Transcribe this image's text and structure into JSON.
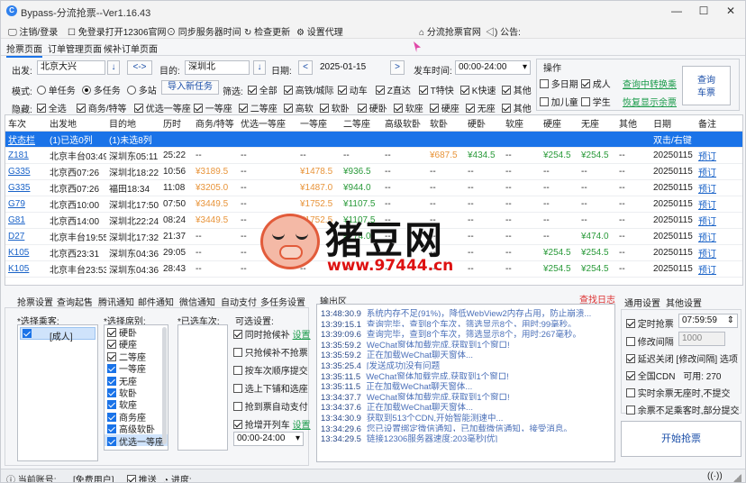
{
  "window": {
    "title": "Bypass-分流抢票--Ver1.16.43",
    "min": "—",
    "max": "☐",
    "close": "✕"
  },
  "menu": {
    "login": "注销/登录",
    "open12306": "免登录打开12306官网",
    "sync_time": "同步服务器时间",
    "check_update": "检查更新",
    "proxy": "设置代理",
    "website": "分流抢票官网",
    "announce": "公告:"
  },
  "tabs": [
    "抢票页面",
    "订单管理页面",
    "候补订单页面"
  ],
  "query": {
    "from_label": "出发:",
    "from": "北京大兴",
    "swap": "<->",
    "to_label": "目的:",
    "to": "深圳北",
    "date_label": "日期:",
    "date": "2025-01-15",
    "prev": "<",
    "next": ">",
    "time_label": "发车时间:",
    "time": "00:00-24:00",
    "arrow": "↓"
  },
  "mode": {
    "label": "模式:",
    "single": "单任务",
    "multi": "多任务",
    "station": "多站",
    "import": "导入新任务",
    "filter_label": "筛选:",
    "filters": [
      "全部",
      "高铁/城际",
      "动车",
      "Z直达",
      "T特快",
      "K快速",
      "其他"
    ]
  },
  "hide": {
    "label": "隐藏:",
    "items": [
      "全选",
      "商务/特等",
      "优选一等座",
      "一等座",
      "二等座",
      "高软",
      "软卧",
      "硬卧",
      "软座",
      "硬座",
      "无座",
      "其他"
    ]
  },
  "ops": {
    "title": "操作",
    "multi_date": "多日期",
    "adult": "成人",
    "transfer": "查询中转换乘",
    "child": "加儿童",
    "student": "学生",
    "restore": "恢复显示余票",
    "query": "查询\n车票"
  },
  "table": {
    "headers": [
      "车次",
      "出发地",
      "目的地",
      "历时",
      "商务/特等",
      "优选一等座",
      "一等座",
      "二等座",
      "高级软卧",
      "软卧",
      "硬卧",
      "软座",
      "硬座",
      "无座",
      "其他",
      "日期",
      "备注"
    ],
    "status_row": [
      "状态栏",
      "(1)已选0列",
      "(1)未选8列",
      "",
      "",
      "",
      "",
      "",
      "",
      "",
      "",
      "",
      "",
      "",
      "",
      "双击/右键",
      ""
    ],
    "rows": [
      [
        "Z181",
        "北京丰台03:49",
        "深圳东05:11",
        "25:22",
        "--",
        "--",
        "--",
        "--",
        "--",
        "¥687.5",
        "¥434.5",
        "--",
        "¥254.5",
        "¥254.5",
        "--",
        "20250115",
        "预订"
      ],
      [
        "G335",
        "北京西07:26",
        "深圳北18:22",
        "10:56",
        "¥3189.5",
        "--",
        "¥1478.5",
        "¥936.5",
        "--",
        "--",
        "--",
        "--",
        "--",
        "--",
        "--",
        "20250115",
        "预订"
      ],
      [
        "G335",
        "北京西07:26",
        "福田18:34",
        "11:08",
        "¥3205.0",
        "--",
        "¥1487.0",
        "¥944.0",
        "--",
        "--",
        "--",
        "--",
        "--",
        "--",
        "--",
        "20250115",
        "预订"
      ],
      [
        "G79",
        "北京西10:00",
        "深圳北17:50",
        "07:50",
        "¥3449.5",
        "--",
        "¥1752.5",
        "¥1107.5",
        "--",
        "--",
        "--",
        "--",
        "--",
        "--",
        "--",
        "20250115",
        "预订"
      ],
      [
        "G81",
        "北京西14:00",
        "深圳北22:24",
        "08:24",
        "¥3449.5",
        "--",
        "¥1752.5",
        "¥1107.5",
        "--",
        "--",
        "--",
        "--",
        "--",
        "--",
        "--",
        "20250115",
        "预订"
      ],
      [
        "D27",
        "北京丰台19:55",
        "深圳北17:32",
        "21:37",
        "--",
        "--",
        "--",
        "¥774.0",
        "--",
        "--",
        "--",
        "--",
        "--",
        "¥474.0",
        "--",
        "20250115",
        "预订"
      ],
      [
        "K105",
        "北京西23:31",
        "深圳东04:36",
        "29:05",
        "--",
        "--",
        "--",
        "--",
        "--",
        "--",
        "--",
        "--",
        "¥254.5",
        "¥254.5",
        "--",
        "20250115",
        "预订"
      ],
      [
        "K105",
        "北京丰台23:53",
        "深圳东04:36",
        "28:43",
        "--",
        "--",
        "--",
        "--",
        "--",
        "--",
        "--",
        "--",
        "¥254.5",
        "¥254.5",
        "--",
        "20250115",
        "预订"
      ]
    ]
  },
  "bottom_tabs": [
    "抢票设置",
    "查询起售",
    "腾讯通知",
    "邮件通知",
    "微信通知",
    "自动支付",
    "多任务设置"
  ],
  "passengers": {
    "label": "*选择乘客:",
    "items": [
      "[成人]"
    ]
  },
  "seats": {
    "label": "*选择席别:",
    "items": [
      "硬卧",
      "硬座",
      "二等座",
      "一等座",
      "无座",
      "软卧",
      "软座",
      "商务座",
      "高级软卧",
      "优选一等座"
    ]
  },
  "trains": {
    "label": "*已选车次:"
  },
  "options": {
    "label": "可选设置:",
    "items": [
      "同时抢候补",
      "只抢候补不抢票",
      "按车次顺序提交",
      "选上下铺和选座",
      "抢到票自动支付",
      "抢增开列车"
    ],
    "set": "设置",
    "time": "00:00-24:00"
  },
  "log": {
    "label": "输出区",
    "clear": "查找日志",
    "lines": [
      [
        "13:48:30.9",
        "系统内存不足(91%)，降低WebView2内存占用，防止崩溃..."
      ],
      [
        "13:39:15.1",
        "查询完毕，查到8个车次，筛选显示8个，用时:99毫秒。"
      ],
      [
        "13:39:09.6",
        "查询完毕，查到8个车次，筛选显示8个，用时:267毫秒。"
      ],
      [
        "13:35:59.2",
        "WeChat窗体加载完成,获取到1个窗口!"
      ],
      [
        "13:35:59.2",
        "正在加载WeChat聊天窗体..."
      ],
      [
        "13:35:25.4",
        "[发送成功]没有问题"
      ],
      [
        "13:35:11.5",
        "WeChat窗体加载完成,获取到1个窗口!"
      ],
      [
        "13:35:11.5",
        "正在加载WeChat聊天窗体..."
      ],
      [
        "13:34:37.7",
        "WeChat窗体加载完成,获取到1个窗口!"
      ],
      [
        "13:34:37.6",
        "正在加载WeChat聊天窗体..."
      ],
      [
        "13:34:30.9",
        "获取到513个CDN,开始智能测速中..."
      ],
      [
        "13:34:29.6",
        "您已设置绑定微信通知，已加载微信通知，接受消息。"
      ],
      [
        "13:34:29.5",
        "链接12306服务器速度:203毫秒[优]"
      ]
    ]
  },
  "settings": {
    "tabs": [
      "通用设置",
      "其他设置"
    ],
    "timed": "定时抢票",
    "timed_value": "07:59:59",
    "interval": "修改间隔",
    "interval_value": "1000",
    "delay": "延迟关闭 [修改间隔] 选项",
    "cdn": "全国CDN",
    "cdn_avail": "可用: 270",
    "realtime": "实时余票无座时,不提交",
    "partial": "余票不足乘客时,部分提交",
    "start": "开始抢票"
  },
  "status": {
    "account_label": "当前账号:",
    "account": "[免费用户]",
    "push": "推送",
    "progress": "进度:"
  },
  "watermark": {
    "text": "猪豆网",
    "url": "www.97444.cn"
  }
}
